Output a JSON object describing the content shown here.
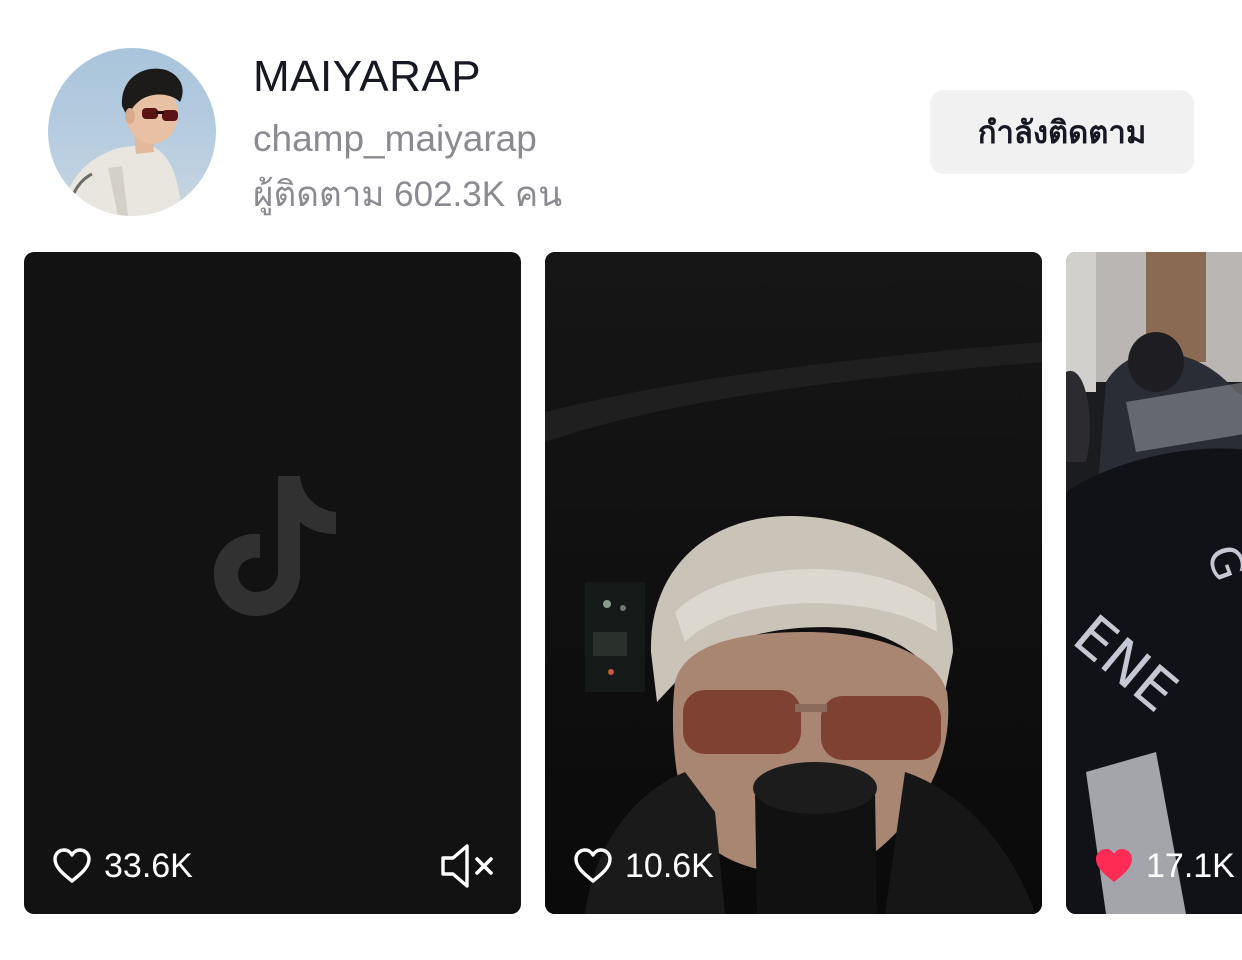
{
  "profile": {
    "display_name": "MAIYARAP",
    "handle": "champ_maiyarap",
    "followers_text": "ผู้ติดตาม 602.3K คน",
    "follow_button_label": "กำลังติดตาม"
  },
  "videos": [
    {
      "likes": "33.6K",
      "liked": false,
      "muted": true
    },
    {
      "likes": "10.6K",
      "liked": false
    },
    {
      "likes": "17.1K",
      "liked": true
    }
  ],
  "colors": {
    "text_primary": "#161823",
    "text_secondary": "#8a8b91",
    "button_bg": "#f1f1f2",
    "like_active": "#fe2c55"
  },
  "icons": {
    "like": "heart-outline-icon",
    "liked": "heart-filled-icon",
    "mute": "speaker-muted-icon",
    "placeholder": "tiktok-logo-icon"
  }
}
